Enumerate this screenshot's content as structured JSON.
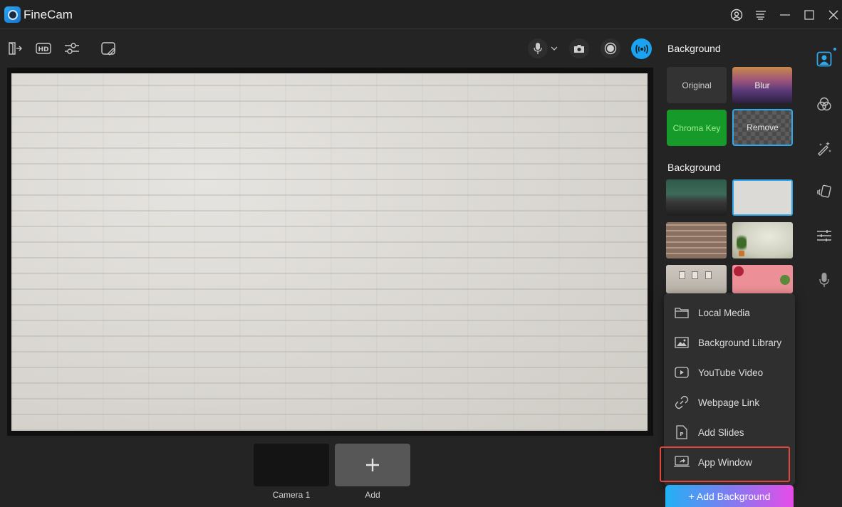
{
  "app": {
    "title": "FineCam",
    "window_controls": [
      "account-icon",
      "menu-icon",
      "minimize-icon",
      "maximize-icon",
      "close-icon"
    ]
  },
  "toolbar": {
    "left_tools": [
      "exit-icon",
      "hd-icon",
      "adjust-icon",
      "whiteboard-icon"
    ],
    "right_tools": [
      "microphone-icon",
      "chevron-down-icon",
      "camera-snapshot-icon",
      "record-icon",
      "live-broadcast-icon"
    ],
    "accent_color": "#1aa3f0"
  },
  "sources": [
    {
      "label": "Camera 1"
    },
    {
      "label": "Add",
      "icon": "plus-icon"
    }
  ],
  "panel": {
    "section1_title": "Background",
    "modes": [
      {
        "label": "Original"
      },
      {
        "label": "Blur"
      },
      {
        "label": "Chroma Key"
      },
      {
        "label": "Remove",
        "selected": true
      }
    ],
    "section2_title": "Background",
    "backgrounds": [
      {
        "name": "office-with-plant"
      },
      {
        "name": "white-brick-wall",
        "selected": true
      },
      {
        "name": "red-brick-wall"
      },
      {
        "name": "plant-corner"
      },
      {
        "name": "gallery-wall"
      },
      {
        "name": "pink-flowers"
      }
    ]
  },
  "menu": {
    "items": [
      {
        "label": "Local Media",
        "icon": "folder-icon"
      },
      {
        "label": "Background Library",
        "icon": "image-icon"
      },
      {
        "label": "YouTube Video",
        "icon": "video-play-icon"
      },
      {
        "label": "Webpage Link",
        "icon": "link-icon"
      },
      {
        "label": "Add Slides",
        "icon": "slides-file-icon"
      },
      {
        "label": "App Window",
        "icon": "app-window-icon",
        "highlighted": true
      }
    ]
  },
  "add_background_label": "+ Add Background",
  "rail": {
    "items": [
      "background-person-icon",
      "filters-icon",
      "effects-wand-icon",
      "stickers-cards-icon",
      "adjust-sliders-icon",
      "audio-mic-icon"
    ],
    "active": "background-person-icon",
    "highlight_color": "#2ea8ec"
  }
}
